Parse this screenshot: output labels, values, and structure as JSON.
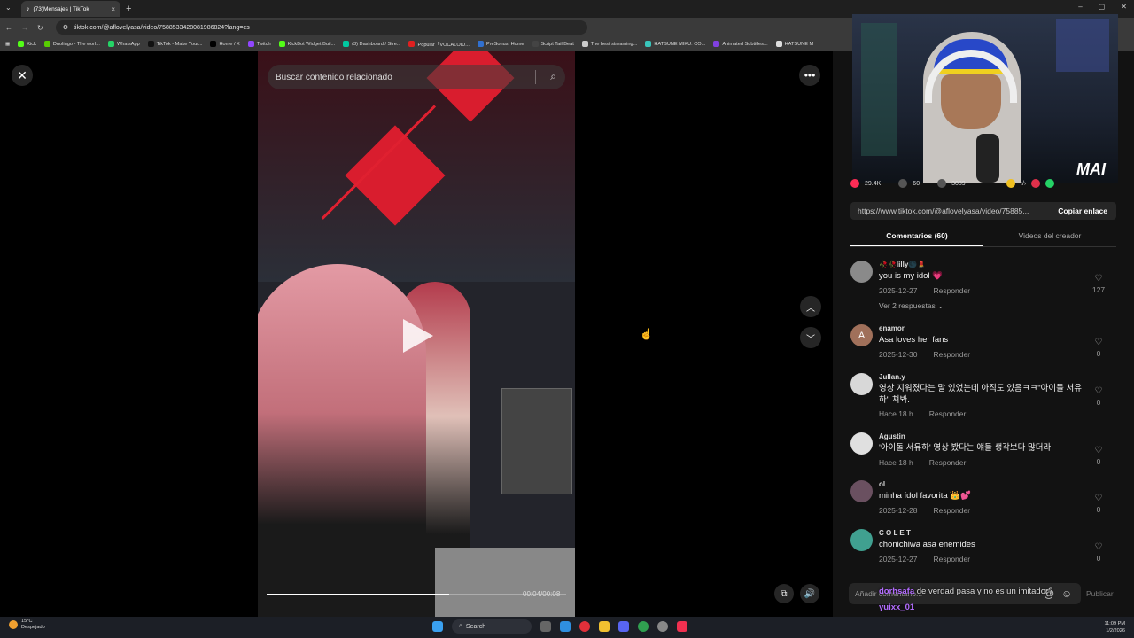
{
  "browser": {
    "tab_title": "(73)Mensajes | TikTok",
    "tab_close": "×",
    "new_tab": "+",
    "url": "tiktok.com/@aflovelyasa/video/7588533428081986824?lang=es",
    "window_controls": [
      "–",
      "▢",
      "✕"
    ],
    "bookmarks": [
      {
        "label": "Kick",
        "color": "#53fc18"
      },
      {
        "label": "Duolingo - The worl...",
        "color": "#58cc02"
      },
      {
        "label": "WhatsApp",
        "color": "#25d366"
      },
      {
        "label": "TikTok - Make Your...",
        "color": "#111111"
      },
      {
        "label": "Home / X",
        "color": "#000000"
      },
      {
        "label": "Twitch",
        "color": "#9146ff"
      },
      {
        "label": "KickBot Widget Buil...",
        "color": "#53fc18"
      },
      {
        "label": "(3) Dashboard / Stre...",
        "color": "#00c8a0"
      },
      {
        "label": "Popular「VOCALOID...",
        "color": "#e02020"
      },
      {
        "label": "PreSonus: Home",
        "color": "#3070d0"
      },
      {
        "label": "Script Tail Beat",
        "color": "#444444"
      },
      {
        "label": "The best streaming...",
        "color": "#cccccc"
      },
      {
        "label": "HATSUNE MIKU: CO...",
        "color": "#39c5bb"
      },
      {
        "label": "Animated Subtitles...",
        "color": "#8040e0"
      },
      {
        "label": "HATSUNE M",
        "color": "#dddddd"
      }
    ]
  },
  "player": {
    "close_icon": "✕",
    "search_placeholder": "Buscar contenido relacionado",
    "search_icon": "⌕",
    "more_icon": "•••",
    "up_icon": "︿",
    "down_icon": "﹀",
    "time": "00:04/00:08",
    "progress": 0.61,
    "pip_icon": "⧉",
    "volume_icon": "🔊"
  },
  "stream": {
    "logo": "MAI"
  },
  "stats": {
    "likes": "29.4K",
    "comments": "60",
    "saves": "3089"
  },
  "share": {
    "url": "https://www.tiktok.com/@aflovelyasa/video/75885...",
    "copy_label": "Copiar enlace"
  },
  "tabs": {
    "comments": "Comentarios (60)",
    "creator_videos": "Videos del creador"
  },
  "comments": [
    {
      "user": "🥀🥀lilly🌑💄",
      "text": "you is my idol 💗",
      "date": "2025-12-27",
      "reply": "Responder",
      "likes": "127",
      "replies_link": "Ver 2 respuestas ⌄",
      "avatar_letter": "",
      "avatar_color": "#8a8a8a"
    },
    {
      "user": "enamor",
      "text": "Asa loves her fans",
      "date": "2025-12-30",
      "reply": "Responder",
      "likes": "0",
      "avatar_letter": "A",
      "avatar_color": "#a0705a"
    },
    {
      "user": "Jullan.y",
      "text": "영상 지워졌다는 말 있었는데 아직도 있음ㅋㅋ\"아이돌 서유하\" 쳐봐.",
      "date": "Hace 18 h",
      "reply": "Responder",
      "likes": "0",
      "avatar_letter": "",
      "avatar_color": "#d8d8d8"
    },
    {
      "user": "Agustin",
      "text": "'아이돌 서유하' 영상 봤다는 얘들 생각보다 많더라",
      "date": "Hace 18 h",
      "reply": "Responder",
      "likes": "0",
      "avatar_letter": "",
      "avatar_color": "#e0e0e0"
    },
    {
      "user": "ol",
      "text": "minha ídol favorita 👑💕",
      "date": "2025-12-28",
      "reply": "Responder",
      "likes": "0",
      "avatar_letter": "",
      "avatar_color": "#6a5060"
    },
    {
      "user": "C O L E T",
      "text": "chonichiwa asa enemides",
      "date": "2025-12-27",
      "reply": "Responder",
      "likes": "0",
      "avatar_letter": "",
      "avatar_color": "#40a090"
    }
  ],
  "composer": {
    "placeholder": "Añadir comentario...",
    "at_icon": "@",
    "emoji_icon": "☺",
    "publish": "Publicar"
  },
  "chat_overlay": {
    "user1": "dorhsafa",
    "msg1": "de verdad pasa y no es un imitador?",
    "user2": "yuixx_01"
  },
  "taskbar": {
    "temp": "15°C",
    "weather": "Despejado",
    "search": "Search",
    "time": "11:09 PM",
    "date": "1/2/2026"
  }
}
